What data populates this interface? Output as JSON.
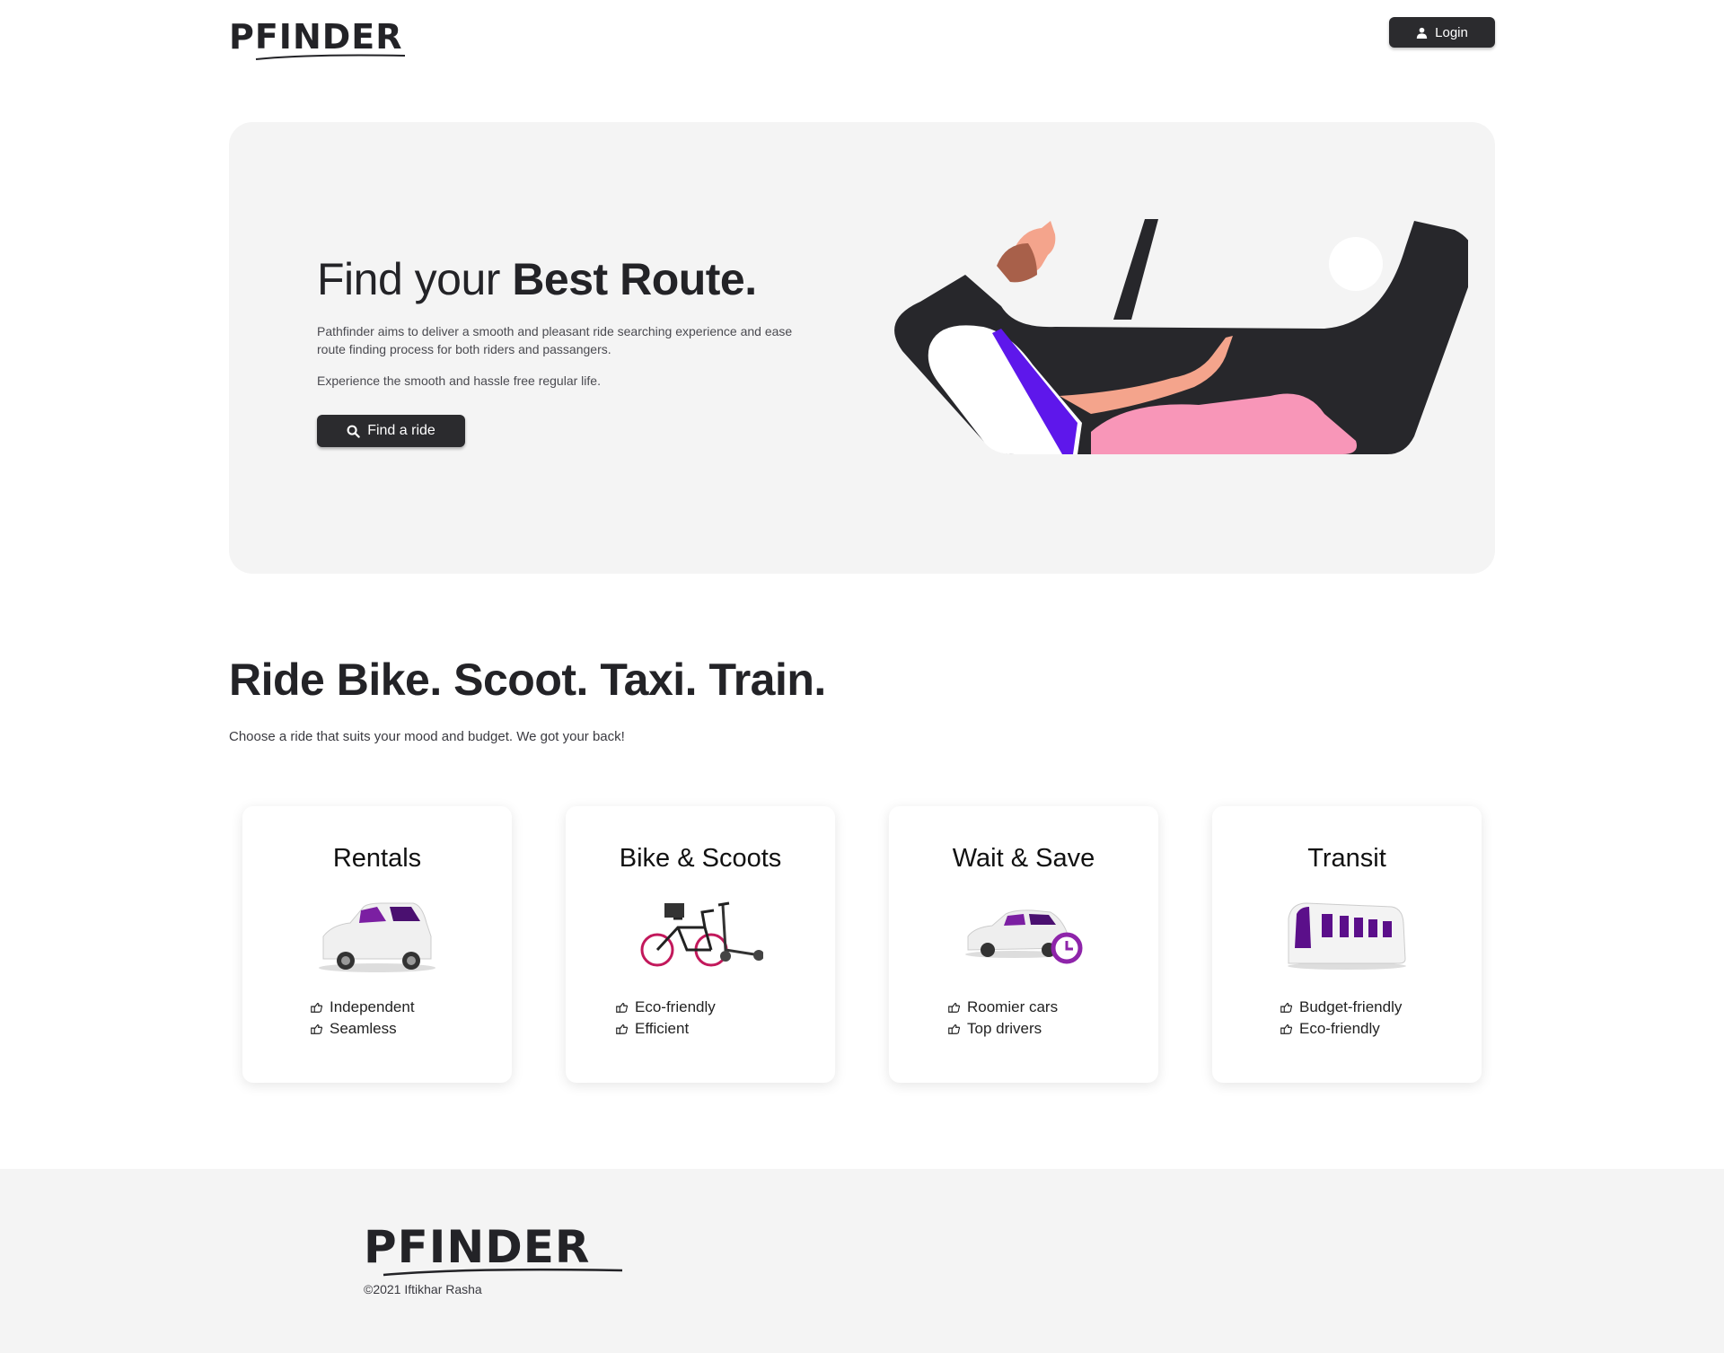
{
  "header": {
    "logo_text": "PFINDER",
    "login_label": "Login"
  },
  "hero": {
    "title_regular": "Find your ",
    "title_bold": "Best Route.",
    "paragraph_1": "Pathfinder aims to deliver a smooth and pleasant ride searching experience and ease route finding process for both riders and passangers.",
    "paragraph_2": "Experience the smooth and hassle free regular life.",
    "button_label": "Find a ride",
    "button_icon": "search-icon"
  },
  "ride_section": {
    "title_bold": "Ride",
    "title_regular": " Bike. Scoot. Taxi. Train.",
    "subtitle": "Choose a ride that suits your mood and budget. We got your back!"
  },
  "cards": [
    {
      "title": "Rentals",
      "image": "car-image",
      "features": [
        "Independent",
        "Seamless"
      ]
    },
    {
      "title": "Bike & Scoots",
      "image": "bike-scooter-image",
      "features": [
        "Eco-friendly",
        "Efficient"
      ]
    },
    {
      "title": "Wait & Save",
      "image": "car-clock-image",
      "features": [
        "Roomier cars",
        "Top drivers"
      ]
    },
    {
      "title": "Transit",
      "image": "train-image",
      "features": [
        "Budget-friendly",
        "Eco-friendly"
      ]
    }
  ],
  "footer": {
    "logo_text": "PFINDER",
    "copyright": "©2021 Iftikhar Rasha"
  },
  "colors": {
    "dark": "#2b2b2e",
    "accent_purple": "#7b1fa2",
    "pink": "#f896b8",
    "hero_bg": "#f4f4f4"
  }
}
